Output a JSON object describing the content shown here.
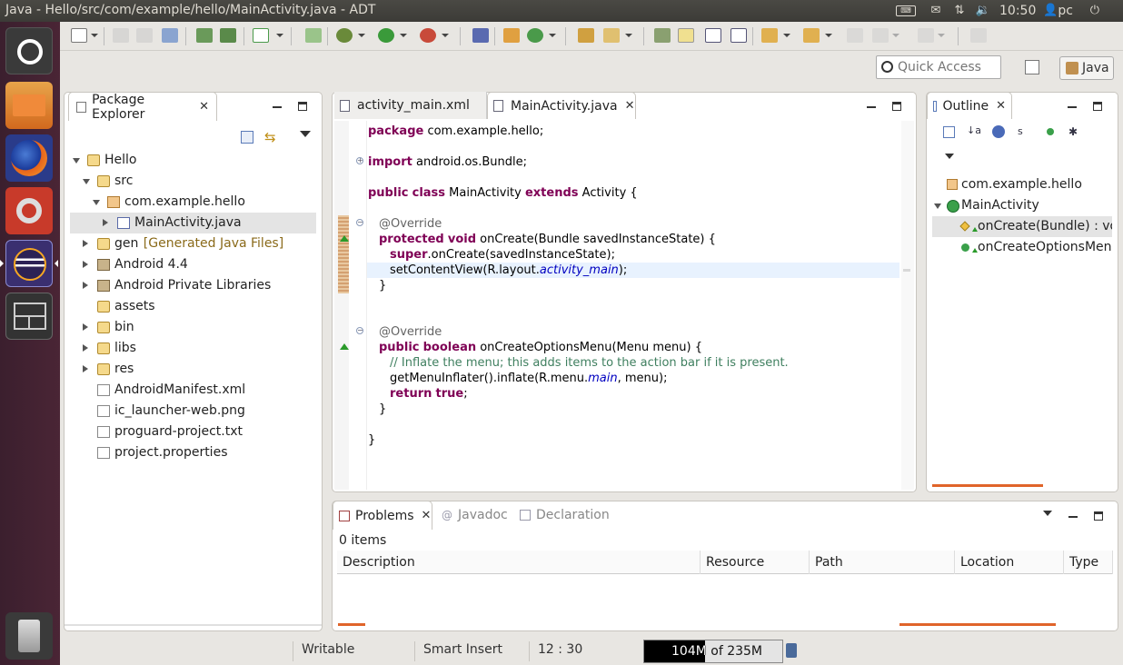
{
  "window": {
    "title": "Java - Hello/src/com/example/hello/MainActivity.java - ADT"
  },
  "tray": {
    "time": "10:50",
    "user": "pc"
  },
  "launcher": {
    "items": [
      "ubuntu-icon",
      "files-icon",
      "firefox-icon",
      "settings-icon",
      "eclipse-icon",
      "workspace-icon",
      "trash-icon"
    ]
  },
  "quick_access": {
    "placeholder": "Quick Access"
  },
  "perspective": {
    "label": "Java"
  },
  "package_explorer": {
    "tab_label": "Package Explorer",
    "tree": [
      {
        "label": "Hello",
        "depth": 0,
        "icon": "project",
        "twist": "open"
      },
      {
        "label": "src",
        "depth": 1,
        "icon": "folder",
        "twist": "open"
      },
      {
        "label": "com.example.hello",
        "depth": 2,
        "icon": "package",
        "twist": "open"
      },
      {
        "label": "MainActivity.java",
        "depth": 3,
        "icon": "java-file",
        "twist": "closed",
        "selected": true
      },
      {
        "label": "gen",
        "suffix": "[Generated Java Files]",
        "depth": 1,
        "icon": "folder",
        "twist": "closed"
      },
      {
        "label": "Android 4.4",
        "depth": 1,
        "icon": "library",
        "twist": "closed"
      },
      {
        "label": "Android Private Libraries",
        "depth": 1,
        "icon": "library",
        "twist": "closed"
      },
      {
        "label": "assets",
        "depth": 1,
        "icon": "folder",
        "twist": "none"
      },
      {
        "label": "bin",
        "depth": 1,
        "icon": "folder",
        "twist": "closed"
      },
      {
        "label": "libs",
        "depth": 1,
        "icon": "folder",
        "twist": "closed"
      },
      {
        "label": "res",
        "depth": 1,
        "icon": "folder",
        "twist": "closed"
      },
      {
        "label": "AndroidManifest.xml",
        "depth": 1,
        "icon": "file",
        "twist": "none"
      },
      {
        "label": "ic_launcher-web.png",
        "depth": 1,
        "icon": "image",
        "twist": "none"
      },
      {
        "label": "proguard-project.txt",
        "depth": 1,
        "icon": "file",
        "twist": "none"
      },
      {
        "label": "project.properties",
        "depth": 1,
        "icon": "file",
        "twist": "none"
      }
    ]
  },
  "editor": {
    "tabs": [
      {
        "label": "activity_main.xml",
        "active": false
      },
      {
        "label": "MainActivity.java",
        "active": true
      }
    ],
    "code": [
      {
        "indent": 0,
        "tokens": [
          {
            "t": "package",
            "c": "kw"
          },
          {
            "t": " com.example.hello;"
          }
        ]
      },
      {
        "indent": 0,
        "tokens": []
      },
      {
        "indent": 0,
        "tokens": [
          {
            "t": "import",
            "c": "kw"
          },
          {
            "t": " android.os.Bundle;"
          }
        ],
        "fold": "plus"
      },
      {
        "indent": 0,
        "tokens": []
      },
      {
        "indent": 0,
        "tokens": [
          {
            "t": "public",
            "c": "kw"
          },
          {
            "t": " "
          },
          {
            "t": "class",
            "c": "kw"
          },
          {
            "t": " MainActivity "
          },
          {
            "t": "extends",
            "c": "kw"
          },
          {
            "t": " Activity {"
          }
        ]
      },
      {
        "indent": 0,
        "tokens": []
      },
      {
        "indent": 1,
        "tokens": [
          {
            "t": "@Override",
            "c": "ann"
          }
        ],
        "fold": "minus"
      },
      {
        "indent": 1,
        "tokens": [
          {
            "t": "protected",
            "c": "kw"
          },
          {
            "t": " "
          },
          {
            "t": "void",
            "c": "kw"
          },
          {
            "t": " onCreate(Bundle savedInstanceState) {"
          }
        ],
        "marker": "override"
      },
      {
        "indent": 2,
        "tokens": [
          {
            "t": "super",
            "c": "kw"
          },
          {
            "t": ".onCreate(savedInstanceState);"
          }
        ]
      },
      {
        "indent": 2,
        "tokens": [
          {
            "t": "setContentView(R.layout."
          },
          {
            "t": "activity_main",
            "c": "it"
          },
          {
            "t": ");"
          }
        ],
        "current": true
      },
      {
        "indent": 1,
        "tokens": [
          {
            "t": "}"
          }
        ]
      },
      {
        "indent": 0,
        "tokens": []
      },
      {
        "indent": 0,
        "tokens": []
      },
      {
        "indent": 1,
        "tokens": [
          {
            "t": "@Override",
            "c": "ann"
          }
        ],
        "fold": "minus"
      },
      {
        "indent": 1,
        "tokens": [
          {
            "t": "public",
            "c": "kw"
          },
          {
            "t": " "
          },
          {
            "t": "boolean",
            "c": "kw"
          },
          {
            "t": " onCreateOptionsMenu(Menu menu) {"
          }
        ],
        "marker": "override"
      },
      {
        "indent": 2,
        "tokens": [
          {
            "t": "// Inflate the menu; this adds items to the action bar if it is present.",
            "c": "cm"
          }
        ]
      },
      {
        "indent": 2,
        "tokens": [
          {
            "t": "getMenuInflater().inflate(R.menu."
          },
          {
            "t": "main",
            "c": "it"
          },
          {
            "t": ", menu);"
          }
        ]
      },
      {
        "indent": 2,
        "tokens": [
          {
            "t": "return",
            "c": "kw"
          },
          {
            "t": " "
          },
          {
            "t": "true",
            "c": "kw"
          },
          {
            "t": ";"
          }
        ]
      },
      {
        "indent": 1,
        "tokens": [
          {
            "t": "}"
          }
        ]
      },
      {
        "indent": 0,
        "tokens": []
      },
      {
        "indent": 0,
        "tokens": [
          {
            "t": "}"
          }
        ]
      }
    ]
  },
  "outline": {
    "tab_label": "Outline",
    "items": [
      {
        "label": "com.example.hello",
        "depth": 0,
        "icon": "package",
        "twist": "none"
      },
      {
        "label": "MainActivity",
        "depth": 0,
        "icon": "class",
        "twist": "open"
      },
      {
        "label": "onCreate(Bundle) : voi",
        "depth": 1,
        "icon": "protected-method",
        "selected": true
      },
      {
        "label": "onCreateOptionsMenu",
        "depth": 1,
        "icon": "public-method"
      }
    ]
  },
  "bottom": {
    "tabs": [
      {
        "label": "Problems",
        "active": true,
        "icon": "problems-icon"
      },
      {
        "label": "Javadoc",
        "active": false,
        "icon": "at-icon"
      },
      {
        "label": "Declaration",
        "active": false,
        "icon": "declaration-icon"
      }
    ],
    "summary": "0 items",
    "columns": [
      "Description",
      "Resource",
      "Path",
      "Location",
      "Type"
    ]
  },
  "status": {
    "mode": "Writable",
    "insert": "Smart Insert",
    "position": "12 : 30",
    "heap_used": "104M",
    "heap_total": "235M",
    "heap_text": "104M of 235M",
    "heap_fraction": 0.44
  },
  "colors": {
    "topbar": "#3c3b37",
    "launcher": "#4a2535",
    "accent_orange": "#e0642a",
    "selection": "#e4e4e4",
    "current_line": "#e8f2fe"
  }
}
